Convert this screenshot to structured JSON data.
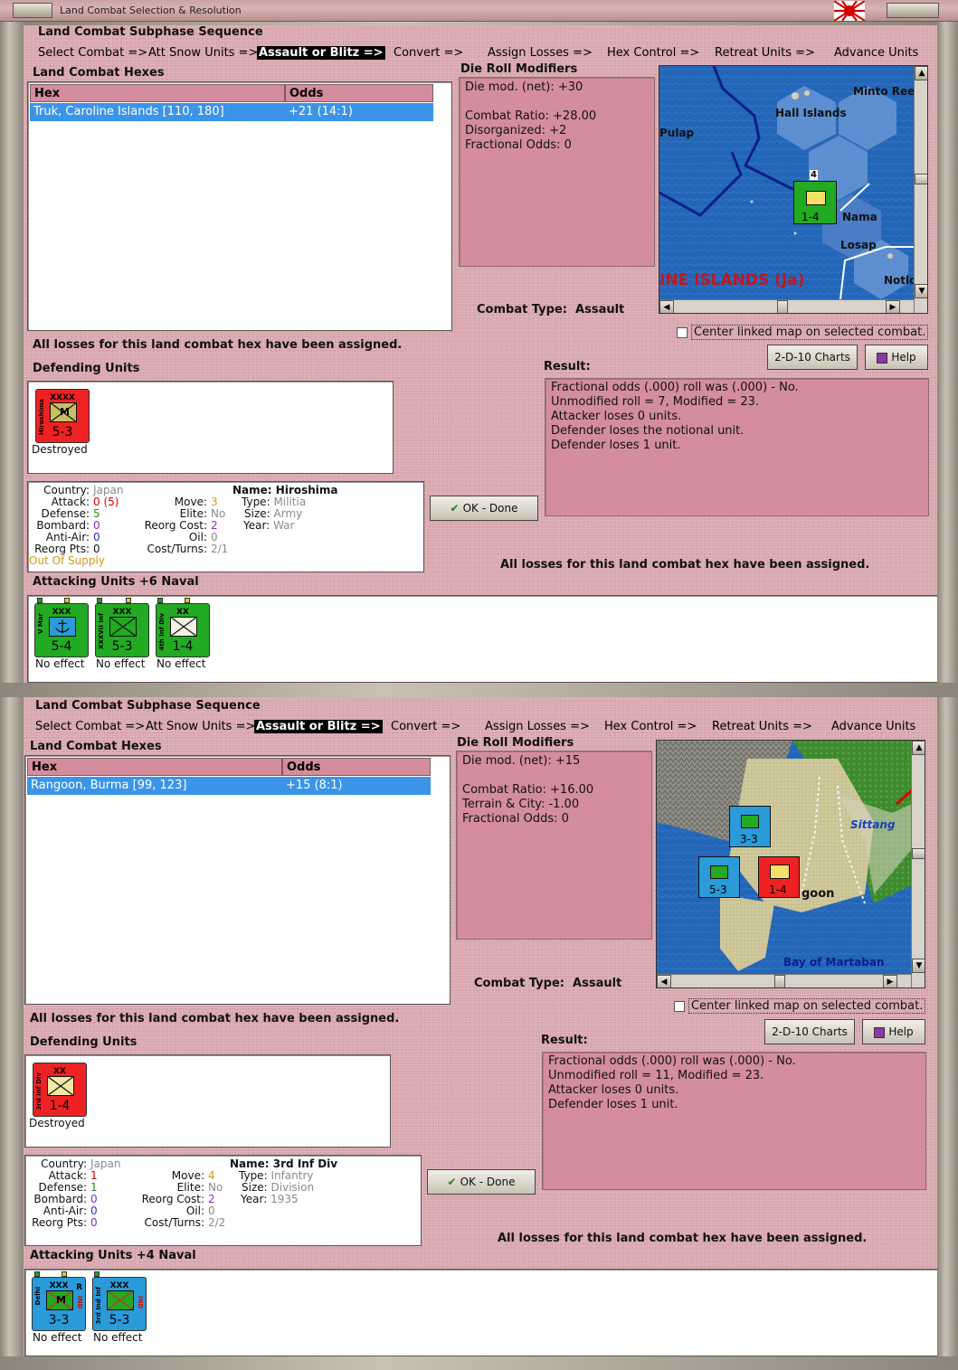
{
  "window": {
    "title": "Land Combat Selection & Resolution"
  },
  "colors": {
    "panel_bg": "#d9a7ae",
    "pink_box": "#d48d9c",
    "selected_row": "#3b94e8",
    "japan_unit": "#22aa22",
    "us_unit": "#2a9ad8",
    "destroyed_unit": "#ee2222"
  },
  "combats": [
    {
      "sequence_title": "Land Combat Subphase Sequence",
      "sequence": [
        "Select Combat =>",
        "Att Snow Units =>",
        "Assault or Blitz =>",
        "Convert =>",
        "Assign Losses =>",
        "Hex Control =>",
        "Retreat Units =>",
        "Advance Units"
      ],
      "hexes_title": "Land Combat Hexes",
      "col_hex": "Hex",
      "col_odds": "Odds",
      "hex_name": "Truk, Caroline Islands [110, 180]",
      "hex_odds": "+21 (14:1)",
      "drm_title": "Die Roll Modifiers",
      "drm_lines": [
        "Die mod. (net): +30",
        "",
        "Combat Ratio: +28.00",
        "Disorganized: +2",
        "Fractional Odds: 0"
      ],
      "combat_type_label": "Combat Type:",
      "combat_type": "Assault",
      "center_map_label": "Center linked map on selected combat.",
      "losses_msg": "All losses for this land combat hex have been assigned.",
      "charts_button": "2-D-10 Charts",
      "help_button": "Help",
      "defending_title": "Defending Units",
      "result_title": "Result:",
      "result_lines": [
        "Fractional odds (.000) roll was (.000)  - No.",
        "Unmodified roll = 7, Modified = 23.",
        "Attacker loses 0 units.",
        "Defender loses the notional unit.",
        "Defender loses 1 unit."
      ],
      "defender": {
        "size": "XXXX",
        "side": "Hiroshima",
        "sym": "M",
        "value": "5-3",
        "status": "Destroyed"
      },
      "details": {
        "country_k": "Country:",
        "country": "Japan",
        "attack_k": "Attack:",
        "attack": "0",
        "attack_extra": "(5)",
        "defense_k": "Defense:",
        "defense": "5",
        "bombard_k": "Bombard:",
        "bombard": "0",
        "antiair_k": "Anti-Air:",
        "antiair": "0",
        "reorgpts_k": "Reorg Pts:",
        "reorgpts": "0",
        "supply": "Out Of Supply",
        "move_k": "Move:",
        "move": "3",
        "elite_k": "Elite:",
        "elite": "No",
        "reorgcost_k": "Reorg Cost:",
        "reorgcost": "2",
        "oil_k": "Oil:",
        "oil": "0",
        "costturns_k": "Cost/Turns:",
        "costturns": "2/1",
        "name_k": "Name:",
        "name": "Hiroshima",
        "type_k": "Type:",
        "type": "Militia",
        "size_k": "Size:",
        "size": "Army",
        "year_k": "Year:",
        "year": "War"
      },
      "ok_button": "OK - Done",
      "attacking_title": "Attacking Units +6 Naval",
      "attackers": [
        {
          "size": "XXX",
          "side": "V Mar",
          "sym": "anchor",
          "value": "5-4",
          "status": "No effect"
        },
        {
          "size": "XXX",
          "side": "XXXVII Inf",
          "sym": "X",
          "value": "5-3",
          "status": "No effect"
        },
        {
          "size": "XX",
          "side": "4th Inf Div",
          "sym": "X",
          "value": "1-4",
          "status": "No effect"
        }
      ],
      "map_labels": {
        "l1": "Minto Reef",
        "l2": "Hall Islands",
        "l3": "Pulap",
        "l4": "Nama",
        "l5": "Losap",
        "l6": "INE ISLANDS (Ja)",
        "l7": "Notlo",
        "l8": "4",
        "l9": "1-4"
      }
    },
    {
      "sequence_title": "Land Combat Subphase Sequence",
      "sequence": [
        "Select Combat =>",
        "Att Snow Units =>",
        "Assault or Blitz =>",
        "Convert =>",
        "Assign Losses =>",
        "Hex Control =>",
        "Retreat Units =>",
        "Advance Units"
      ],
      "hexes_title": "Land Combat Hexes",
      "col_hex": "Hex",
      "col_odds": "Odds",
      "hex_name": "Rangoon, Burma [99, 123]",
      "hex_odds": "+15 (8:1)",
      "drm_title": "Die Roll Modifiers",
      "drm_lines": [
        "Die mod. (net): +15",
        "",
        "Combat Ratio: +16.00",
        "Terrain & City: -1.00",
        "Fractional Odds: 0"
      ],
      "combat_type_label": "Combat Type:",
      "combat_type": "Assault",
      "center_map_label": "Center linked map on selected combat.",
      "losses_msg": "All losses for this land combat hex have been assigned.",
      "charts_button": "2-D-10 Charts",
      "help_button": "Help",
      "defending_title": "Defending Units",
      "result_title": "Result:",
      "result_lines": [
        "Fractional odds (.000) roll was (.000)  - No.",
        "Unmodified roll = 11, Modified = 23.",
        "Attacker loses 0 units.",
        "Defender loses 1 unit."
      ],
      "defender": {
        "size": "XX",
        "side": "3rd Inf Div",
        "sym": "X",
        "value": "1-4",
        "status": "Destroyed"
      },
      "details": {
        "country_k": "Country:",
        "country": "Japan",
        "attack_k": "Attack:",
        "attack": "1",
        "attack_extra": "",
        "defense_k": "Defense:",
        "defense": "1",
        "bombard_k": "Bombard:",
        "bombard": "0",
        "antiair_k": "Anti-Air:",
        "antiair": "0",
        "reorgpts_k": "Reorg Pts:",
        "reorgpts": "0",
        "supply": "",
        "move_k": "Move:",
        "move": "4",
        "elite_k": "Elite:",
        "elite": "No",
        "reorgcost_k": "Reorg Cost:",
        "reorgcost": "2",
        "oil_k": "Oil:",
        "oil": "0",
        "costturns_k": "Cost/Turns:",
        "costturns": "2/2",
        "name_k": "Name:",
        "name": "3rd Inf Div",
        "type_k": "Type:",
        "type": "Infantry",
        "size_k": "Size:",
        "size": "Division",
        "year_k": "Year:",
        "year": "1935"
      },
      "ok_button": "OK - Done",
      "attacking_title": "Attacking Units +4 Naval",
      "attackers": [
        {
          "size": "XXX",
          "side": "Delhi",
          "sym": "M",
          "value": "3-3",
          "status": "No effect",
          "tag": "R",
          "ind": "IND"
        },
        {
          "size": "XXX",
          "side": "3rd Ind Inf",
          "sym": "X",
          "value": "5-3",
          "status": "No effect",
          "tag": "",
          "ind": "IND"
        }
      ],
      "map_labels": {
        "l1": "Sittang",
        "l2": "goon",
        "l3": "Bay of Martaban",
        "l4": "3-3",
        "l5": "5-3",
        "l6": "1-4"
      }
    }
  ]
}
